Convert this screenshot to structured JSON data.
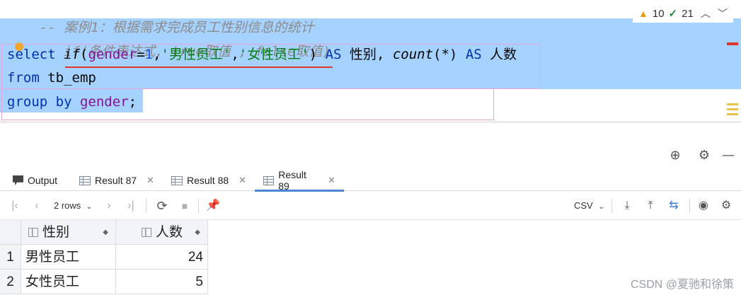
{
  "editor": {
    "line0": {
      "comment": "-- 案例1：根据需求完成员工性别信息的统计"
    },
    "line1": {
      "comment": "-- if(条件表达式, true取值 , false取值)"
    },
    "line2": {
      "kw_select": "select",
      "fn_if": "if",
      "p_open": "(",
      "field_gender": "gender",
      "eq": "=",
      "num_1": "1",
      "comma1": ",",
      "str_male": "'男性员工'",
      "comma2": ",",
      "str_female": "'女性员工'",
      "p_close": ")",
      "kw_as1": "AS",
      "alias_gender": "性别",
      "comma3": ",",
      "fn_count": "count",
      "count_args": "(*)",
      "kw_as2": "AS",
      "alias_count": "人数"
    },
    "line3": {
      "kw_from": "from",
      "table": "tb_emp"
    },
    "line4": {
      "kw_group_by": "group by",
      "field": "gender",
      "semi": ";"
    },
    "inspections": {
      "warnings": "10",
      "ok": "21"
    }
  },
  "tabs": [
    {
      "label": "Output",
      "icon": "output-icon"
    },
    {
      "label": "Result 87",
      "icon": "grid-icon"
    },
    {
      "label": "Result 88",
      "icon": "grid-icon"
    },
    {
      "label": "Result 89",
      "icon": "grid-icon",
      "active": true
    }
  ],
  "toolbar": {
    "rows_label": "2 rows",
    "export_format": "CSV"
  },
  "table": {
    "columns": [
      "性别",
      "人数"
    ],
    "rows": [
      {
        "index": "1",
        "gender": "男性员工",
        "count": "24"
      },
      {
        "index": "2",
        "gender": "女性员工",
        "count": "5"
      }
    ]
  },
  "watermark": "CSDN @夏驰和徐策",
  "colors": {
    "selection": "#a6d2ff",
    "keyword": "#0033b3",
    "string": "#067d17",
    "field": "#871094",
    "error": "#e0342c"
  }
}
